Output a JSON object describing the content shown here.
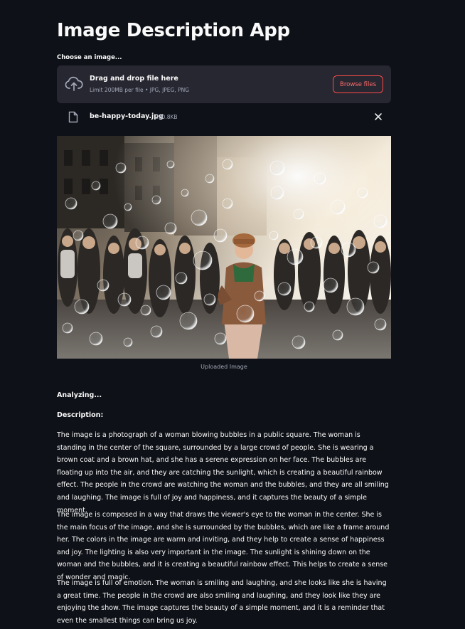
{
  "app": {
    "title": "Image Description App"
  },
  "uploader": {
    "label": "Choose an image...",
    "drop_title": "Drag and drop file here",
    "drop_subtitle": "Limit 200MB per file • JPG, JPEG, PNG",
    "browse_label": "Browse files",
    "upload_icon": "cloud-upload-icon",
    "file_icon": "file-icon",
    "close_icon": "close-icon",
    "accent_color": "#ff4b4b"
  },
  "file": {
    "name": "be-happy-today.jpg",
    "size": "230.8KB"
  },
  "image": {
    "caption": "Uploaded Image"
  },
  "output": {
    "status": "Analyzing...",
    "heading": "Description:",
    "paragraphs": [
      "The image is a photograph of a woman blowing bubbles in a public square. The woman is standing in the center of the square, surrounded by a large crowd of people. She is wearing a brown coat and a brown hat, and she has a serene expression on her face. The bubbles are floating up into the air, and they are catching the sunlight, which is creating a beautiful rainbow effect. The people in the crowd are watching the woman and the bubbles, and they are all smiling and laughing. The image is full of joy and happiness, and it captures the beauty of a simple moment.",
      "The image is composed in a way that draws the viewer's eye to the woman in the center. She is the main focus of the image, and she is surrounded by the bubbles, which are like a frame around her. The colors in the image are warm and inviting, and they help to create a sense of happiness and joy. The lighting is also very important in the image. The sunlight is shining down on the woman and the bubbles, and it is creating a beautiful rainbow effect. This helps to create a sense of wonder and magic.",
      "The image is full of emotion. The woman is smiling and laughing, and she looks like she is having a great time. The people in the crowd are also smiling and laughing, and they look like they are enjoying the show. The image captures the beauty of a simple moment, and it is a reminder that even the smallest things can bring us joy."
    ]
  },
  "colors": {
    "background": "#0e1117",
    "dropzone": "#262730",
    "muted_text": "#a3a8b8"
  }
}
